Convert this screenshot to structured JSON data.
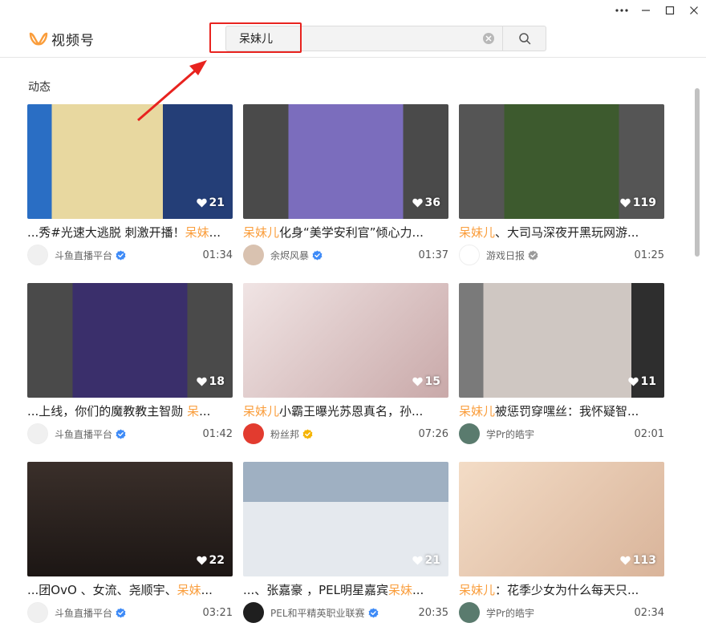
{
  "app": {
    "title": "视频号"
  },
  "search": {
    "value": "呆妹儿"
  },
  "section": {
    "title": "动态"
  },
  "colors": {
    "highlight": "#fa9d3b",
    "annotation": "#e8231f",
    "verified_blue": "#3d8af7",
    "verified_gray": "#9a9a9a",
    "verified_gold": "#f5b400"
  },
  "cards": [
    {
      "likes": "21",
      "caption_pre": "...秀#光速大逃脱 刺激开播！",
      "caption_hl": "呆妹",
      "caption_post": "...",
      "author": "斗鱼直播平台",
      "verified": "blue",
      "duration": "01:34"
    },
    {
      "likes": "36",
      "caption_pre": "",
      "caption_hl": "呆妹儿",
      "caption_post": "化身“美学安利官”倾心力...",
      "author": "余烬风暴",
      "verified": "blue",
      "duration": "01:37"
    },
    {
      "likes": "119",
      "caption_pre": "",
      "caption_hl": "呆妹儿",
      "caption_post": "、大司马深夜开黑玩网游...",
      "author": "游戏日报",
      "verified": "gray",
      "duration": "01:25"
    },
    {
      "likes": "18",
      "caption_pre": "...上线，你们的魔教教主智勋 ",
      "caption_hl": "呆",
      "caption_post": "...",
      "author": "斗鱼直播平台",
      "verified": "blue",
      "duration": "01:42"
    },
    {
      "likes": "15",
      "caption_pre": "",
      "caption_hl": "呆妹儿",
      "caption_post": "小霸王曝光苏恩真名，孙...",
      "author": "粉丝邦",
      "verified": "gold",
      "duration": "07:26"
    },
    {
      "likes": "11",
      "caption_pre": "",
      "caption_hl": "呆妹儿",
      "caption_post": "被惩罚穿嘿丝：我怀疑智...",
      "author": "学Pr的皓宇",
      "verified": "none",
      "duration": "02:01"
    },
    {
      "likes": "22",
      "caption_pre": "...团OvO 、女流、尧顺宇、",
      "caption_hl": "呆妹",
      "caption_post": "...",
      "author": "斗鱼直播平台",
      "verified": "blue",
      "duration": "03:21"
    },
    {
      "likes": "21",
      "caption_pre": "...、张嘉豪 ，PEL明星嘉宾",
      "caption_hl": "呆妹",
      "caption_post": "...",
      "author": "PEL和平精英职业联赛",
      "verified": "blue",
      "duration": "20:35"
    },
    {
      "likes": "113",
      "caption_pre": "",
      "caption_hl": "呆妹儿",
      "caption_post": "：花季少女为什么每天只...",
      "author": "学Pr的皓宇",
      "verified": "none",
      "duration": "02:34"
    }
  ]
}
